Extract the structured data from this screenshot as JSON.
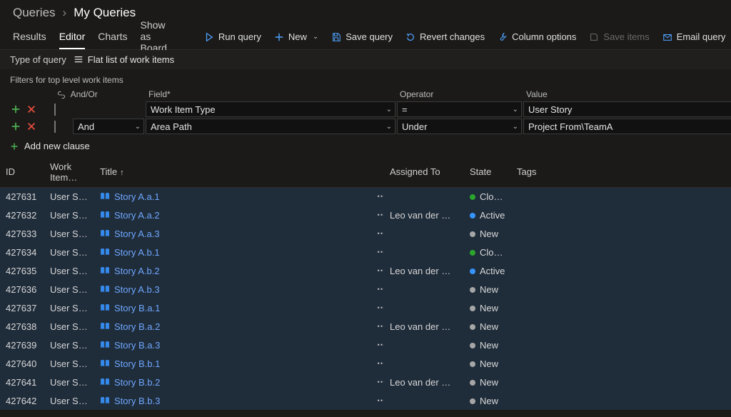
{
  "breadcrumb": {
    "parent": "Queries",
    "sep": "›",
    "current": "My Queries"
  },
  "tabs": [
    "Results",
    "Editor",
    "Charts",
    "Show as Board"
  ],
  "active_tab": 1,
  "commands": {
    "run": "Run query",
    "new": "New",
    "save": "Save query",
    "revert": "Revert changes",
    "columns": "Column options",
    "saveitems": "Save items",
    "email": "Email query"
  },
  "typeofquery": {
    "label": "Type of query",
    "option": "Flat list of work items"
  },
  "filters": {
    "caption": "Filters for top level work items",
    "head": {
      "andor": "And/Or",
      "field": "Field*",
      "operator": "Operator",
      "value": "Value"
    },
    "rows": [
      {
        "andor": "",
        "field": "Work Item Type",
        "operator": "=",
        "value": "User Story",
        "show_andor_dd": false
      },
      {
        "andor": "And",
        "field": "Area Path",
        "operator": "Under",
        "value": "Project From\\TeamA",
        "show_andor_dd": true
      }
    ],
    "addclause": "Add new clause"
  },
  "columns": {
    "id": "ID",
    "wit": "Work Item…",
    "title": "Title",
    "assigned": "Assigned To",
    "state": "State",
    "tags": "Tags"
  },
  "state_colors": {
    "Closed": "#2ba52e",
    "Active": "#3794ff",
    "New": "#a6a6a6"
  },
  "rows": [
    {
      "id": "427631",
      "wit": "User Story",
      "title": "Story A.a.1",
      "assigned": "",
      "state": "Closed"
    },
    {
      "id": "427632",
      "wit": "User Story",
      "title": "Story A.a.2",
      "assigned": "Leo van der Meulen",
      "state": "Active"
    },
    {
      "id": "427633",
      "wit": "User Story",
      "title": "Story A.a.3",
      "assigned": "",
      "state": "New"
    },
    {
      "id": "427634",
      "wit": "User Story",
      "title": "Story A.b.1",
      "assigned": "",
      "state": "Closed"
    },
    {
      "id": "427635",
      "wit": "User Story",
      "title": "Story A.b.2",
      "assigned": "Leo van der Meulen",
      "state": "Active"
    },
    {
      "id": "427636",
      "wit": "User Story",
      "title": "Story A.b.3",
      "assigned": "",
      "state": "New"
    },
    {
      "id": "427637",
      "wit": "User Story",
      "title": "Story B.a.1",
      "assigned": "",
      "state": "New"
    },
    {
      "id": "427638",
      "wit": "User Story",
      "title": "Story B.a.2",
      "assigned": "Leo van der Meulen",
      "state": "New"
    },
    {
      "id": "427639",
      "wit": "User Story",
      "title": "Story B.a.3",
      "assigned": "",
      "state": "New"
    },
    {
      "id": "427640",
      "wit": "User Story",
      "title": "Story B.b.1",
      "assigned": "",
      "state": "New"
    },
    {
      "id": "427641",
      "wit": "User Story",
      "title": "Story B.b.2",
      "assigned": "Leo van der Meulen",
      "state": "New"
    },
    {
      "id": "427642",
      "wit": "User Story",
      "title": "Story B.b.3",
      "assigned": "",
      "state": "New"
    }
  ]
}
